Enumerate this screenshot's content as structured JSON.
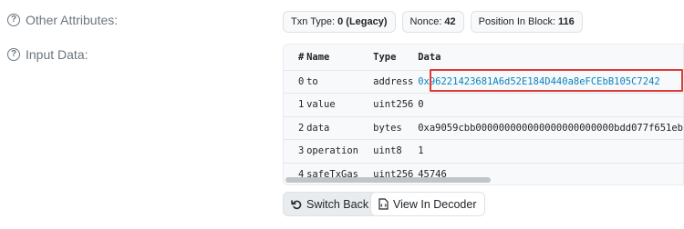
{
  "labels": {
    "other_attributes": "Other Attributes:",
    "input_data": "Input Data:"
  },
  "badges": {
    "txn_type_label": "Txn Type:",
    "txn_type_value": "0 (Legacy)",
    "nonce_label": "Nonce:",
    "nonce_value": "42",
    "position_label": "Position In Block:",
    "position_value": "116"
  },
  "input_table": {
    "headers": {
      "index": "#",
      "name": "Name",
      "type": "Type",
      "data": "Data"
    },
    "rows": [
      {
        "index": "0",
        "name": "to",
        "type": "address",
        "data": "0x96221423681A6d52E184D440a8eFCEbB105C7242"
      },
      {
        "index": "1",
        "name": "value",
        "type": "uint256",
        "data": "0"
      },
      {
        "index": "2",
        "name": "data",
        "type": "bytes",
        "data": "0xa9059cbb000000000000000000000000bdd077f651eb"
      },
      {
        "index": "3",
        "name": "operation",
        "type": "uint8",
        "data": "1"
      },
      {
        "index": "4",
        "name": "safeTxGas",
        "type": "uint256",
        "data": "45746"
      }
    ]
  },
  "buttons": {
    "switch_back": "Switch Back",
    "view_in_decoder": "View In Decoder"
  },
  "colors": {
    "link": "#0784c3",
    "highlight_border": "#e03a3a"
  },
  "icons": [
    "question-circle-icon",
    "undo-arrow-icon",
    "file-code-icon"
  ]
}
